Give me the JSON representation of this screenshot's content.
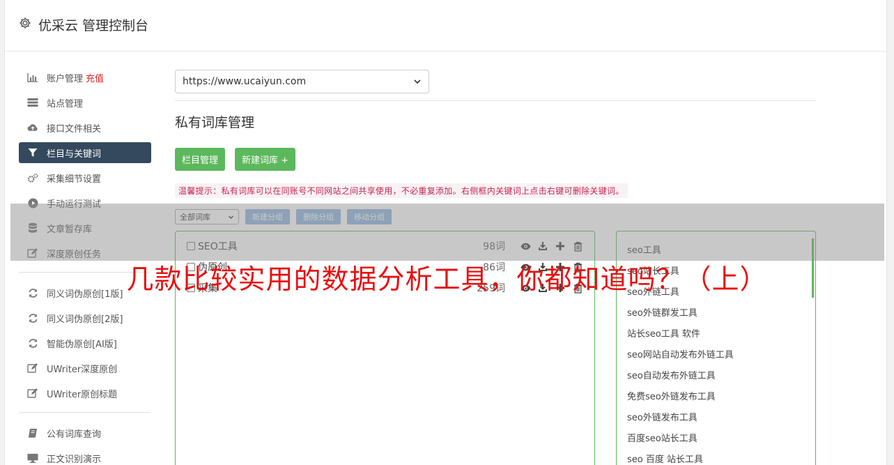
{
  "header": {
    "title": "优采云 管理控制台"
  },
  "sidebar": {
    "group1": [
      {
        "label": "账户管理",
        "badge": "充值",
        "icon": "bar-chart-icon"
      },
      {
        "label": "站点管理",
        "icon": "server-icon"
      },
      {
        "label": "接口文件相关",
        "icon": "cloud-upload-icon"
      },
      {
        "label": "栏目与关键词",
        "icon": "filter-icon",
        "active": true
      },
      {
        "label": "采集细节设置",
        "icon": "cogs-icon"
      },
      {
        "label": "手动运行测试",
        "icon": "play-circle-icon"
      },
      {
        "label": "文章暂存库",
        "icon": "database-icon"
      },
      {
        "label": "深度原创任务",
        "icon": "edit-icon"
      }
    ],
    "group2": [
      {
        "label": "同义词伪原创[1版]",
        "icon": "refresh-icon"
      },
      {
        "label": "同义词伪原创[2版]",
        "icon": "refresh-icon"
      },
      {
        "label": "智能伪原创[AI版]",
        "icon": "refresh-icon"
      },
      {
        "label": "UWriter深度原创",
        "icon": "edit-icon"
      },
      {
        "label": "UWriter原创标题",
        "icon": "edit-icon"
      }
    ],
    "group3": [
      {
        "label": "公有词库查询",
        "icon": "book-icon"
      },
      {
        "label": "正文识别演示",
        "icon": "desktop-icon"
      }
    ]
  },
  "main": {
    "site_select": {
      "value": "https://www.ucaiyun.com"
    },
    "section_title": "私有词库管理",
    "buttons": {
      "column_manage": "栏目管理",
      "new_library": "新建词库 +"
    },
    "tip": "温馨提示：私有词库可以在同账号不同网站之间共享使用，不必重复添加。右侧框内关键词上点击右键可删除关键词。",
    "toolbar": {
      "library_select": "全部词库",
      "new_group": "新建分组",
      "delete_group": "删除分组",
      "move_group": "移动分组"
    },
    "groups": [
      {
        "name": "SEO工具",
        "count": "98词"
      },
      {
        "name": "伪原创",
        "count": "86词"
      },
      {
        "name": "采集",
        "count": "259词"
      }
    ],
    "keywords": [
      "seo工具",
      "seo站长工具",
      "seo外链工具",
      "seo外链群发工具",
      "站长seo工具 软件",
      "seo网站自动发布外链工具",
      "seo自动发布外链工具",
      "免费seo外链发布工具",
      "seo外链发布工具",
      "百度seo站长工具",
      "seo 百度 站长工具"
    ]
  },
  "overlay": {
    "title": "几款比较实用的数据分析工具，你都知道吗？（上）"
  },
  "colors": {
    "active_nav": "#34495e",
    "green": "#5cb85c",
    "blue_btn": "#8fb4e0",
    "overlay_text": "#e81010"
  }
}
